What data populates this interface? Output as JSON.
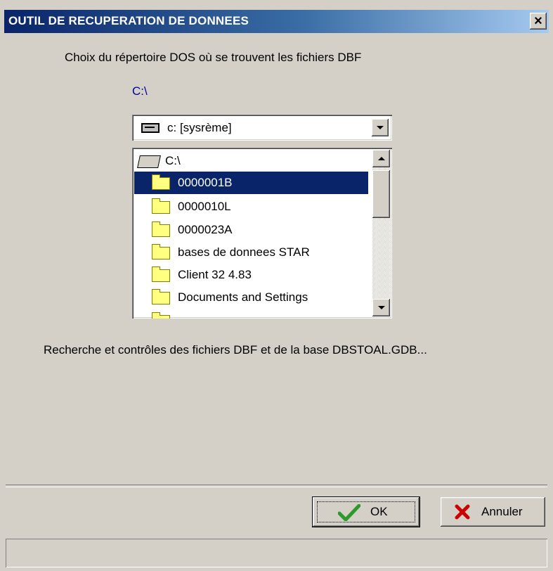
{
  "window": {
    "title": "OUTIL DE RECUPERATION DE DONNEES",
    "close_glyph": "✕"
  },
  "content": {
    "prompt": "Choix du répertoire DOS où se trouvent les fichiers  DBF",
    "current_path": "C:\\",
    "drive_select": {
      "value": "c: [sysrème]",
      "icon": "drive-icon"
    },
    "directory_list": {
      "root": "C:\\",
      "items": [
        {
          "label": "0000001B",
          "selected": true
        },
        {
          "label": "0000010L",
          "selected": false
        },
        {
          "label": "0000023A",
          "selected": false
        },
        {
          "label": "bases de donnees STAR",
          "selected": false
        },
        {
          "label": "Client 32 4.83",
          "selected": false
        },
        {
          "label": "Documents and Settings",
          "selected": false
        }
      ]
    },
    "status_message": "Recherche et contrôles des fichiers DBF et de la base  DBSTOAL.GDB..."
  },
  "buttons": {
    "ok_label": "OK",
    "cancel_label": "Annuler"
  },
  "colors": {
    "title_bar": "#0a246a",
    "selection": "#0a246a",
    "path_text": "#0000a0",
    "ok_check": "#2a9a2a",
    "cancel_x": "#cc0000"
  }
}
